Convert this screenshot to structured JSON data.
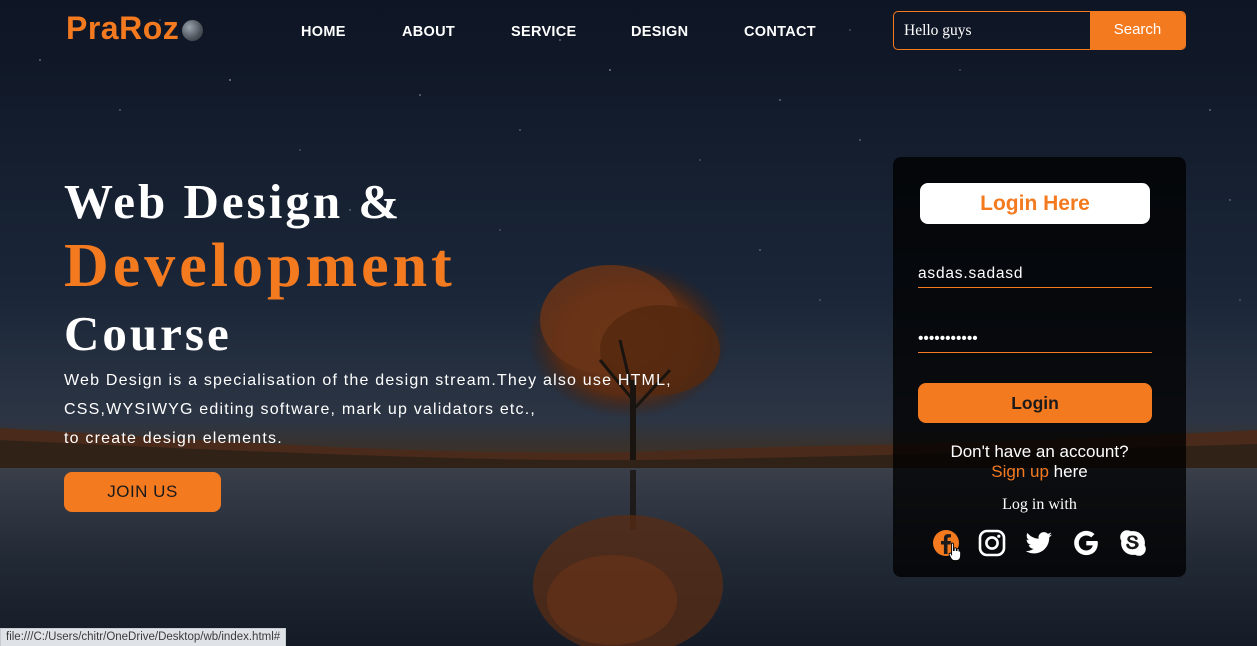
{
  "header": {
    "logo": "PraRoz",
    "nav": [
      {
        "label": "HOME"
      },
      {
        "label": "ABOUT"
      },
      {
        "label": "SERVICE"
      },
      {
        "label": "DESIGN"
      },
      {
        "label": "CONTACT"
      }
    ],
    "search": {
      "value": "Hello guys",
      "button_label": "Search"
    }
  },
  "hero": {
    "line1": "Web Design &",
    "line2": "Development",
    "line3": "Course",
    "description": [
      "Web Design is a specialisation of the design stream.They also use HTML,",
      "CSS,WYSIWYG editing software, mark up validators etc.,",
      "to create design elements."
    ],
    "join_label": "JOIN US"
  },
  "login": {
    "title": "Login Here",
    "username_value": "asdas.sadasd",
    "password_value": "•••••••••••",
    "button_label": "Login",
    "no_account_text": "Don't have an account?",
    "signup_link": "Sign up",
    "signup_suffix": " here",
    "login_with": "Log in with",
    "social": [
      {
        "icon": "facebook-icon"
      },
      {
        "icon": "instagram-icon"
      },
      {
        "icon": "twitter-icon"
      },
      {
        "icon": "google-icon"
      },
      {
        "icon": "skype-icon"
      }
    ]
  },
  "status_bar": {
    "url": "file:///C:/Users/chitr/OneDrive/Desktop/wb/index.html#"
  },
  "colors": {
    "accent": "#f47a20",
    "card_bg": "#000000",
    "sky": "#142033"
  }
}
